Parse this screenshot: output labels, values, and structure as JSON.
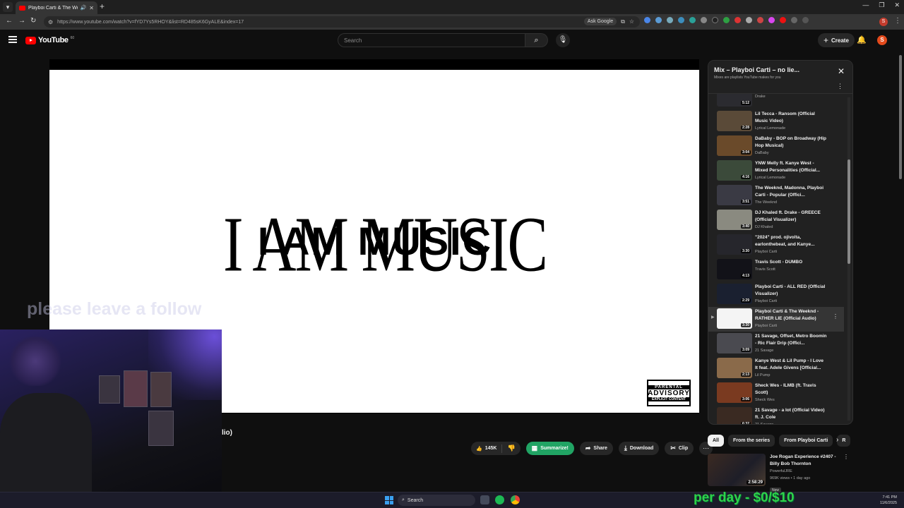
{
  "browser": {
    "tab_title": "Playboi Carti & The Weeknd",
    "url": "https://www.youtube.com/watch?v=fYD7Ys5RHOY&list=RD485sK6GyALE&index=17",
    "ask_google_label": "Ask Google",
    "account_initial": "S"
  },
  "header": {
    "logo_text": "YouTube",
    "logo_region": "60",
    "search_placeholder": "Search",
    "create_label": "Create",
    "avatar_initial": "S"
  },
  "player": {
    "art_line_1": "I AM MUSIC",
    "art_line_2": "I AM MUSIC",
    "advisory_top": "PARENTAL",
    "advisory_mid": "ADVISORY",
    "advisory_bottom": "EXPLICIT CONTENT"
  },
  "stream_overlay": {
    "follow_text": "please leave a follow",
    "per_day_text": "per day - $0/$10"
  },
  "video": {
    "title_fragment": "lio)",
    "like_count": "145K",
    "summarize_label": "Summarize!",
    "share_label": "Share",
    "download_label": "Download",
    "clip_label": "Clip"
  },
  "playlist": {
    "title": "Mix – Playboi Carti – no lie...",
    "subtitle": "Mixes are playlists YouTube makes for you",
    "items": [
      {
        "title": "Music Video)",
        "channel": "Drake",
        "duration": "5:12",
        "thumb": "#2b2b30"
      },
      {
        "title": "Lil Tecca - Ransom (Official Music Video)",
        "channel": "Lyrical Lemonade",
        "duration": "2:28",
        "thumb": "#5a4a38"
      },
      {
        "title": "DaBaby - BOP on Broadway (Hip Hop Musical)",
        "channel": "DaBaby",
        "duration": "3:04",
        "thumb": "#6a4a2a"
      },
      {
        "title": "YNW Melly ft. Kanye West - Mixed Personalities (Official...",
        "channel": "Lyrical Lemonade",
        "duration": "4:16",
        "thumb": "#3b4a3a"
      },
      {
        "title": "The Weeknd, Madonna, Playboi Carti - Popular (Offici...",
        "channel": "The Weeknd",
        "duration": "3:51",
        "thumb": "#3a3a44"
      },
      {
        "title": "DJ Khaled ft. Drake - GREECE (Official Visualizer)",
        "channel": "DJ Khaled",
        "duration": "3:40",
        "thumb": "#8a8a80"
      },
      {
        "title": "\"2024\" prod. ojivolta, earlonthebeat, and Kanye...",
        "channel": "Playboi Carti",
        "duration": "3:30",
        "thumb": "#26262c"
      },
      {
        "title": "Travis Scott - DUMBO",
        "channel": "Travis Scott",
        "duration": "4:13",
        "thumb": "#121218"
      },
      {
        "title": "Playboi Carti - ALL RED (Official Visualizer)",
        "channel": "Playboi Carti",
        "duration": "2:29",
        "thumb": "#1a2030"
      },
      {
        "title": "Playboi Carti & The Weeknd - RATHER LIE (Official Audio)",
        "channel": "Playboi Carti",
        "duration": "3:30",
        "thumb": "#f4f4f4",
        "current": true
      },
      {
        "title": "21 Savage, Offset, Metro Boomin - Ric Flair Drip (Offici...",
        "channel": "21 Savage",
        "duration": "3:09",
        "thumb": "#4a4a50"
      },
      {
        "title": "Kanye West & Lil Pump - I Love It feat. Adele Givens [Official...",
        "channel": "Lil Pump",
        "duration": "2:13",
        "thumb": "#8a6a4a"
      },
      {
        "title": "Sheck Wes - ILMB (ft. Travis Scott)",
        "channel": "Sheck Wes",
        "duration": "3:06",
        "thumb": "#7a3a20"
      },
      {
        "title": "21 Savage - a lot (Official Video) ft. J. Cole",
        "channel": "21 Savage",
        "duration": "6:32",
        "thumb": "#3a2a22"
      }
    ]
  },
  "chips": [
    "All",
    "From the series",
    "From Playboi Carti",
    "R"
  ],
  "recommended": {
    "title": "Joe Rogan Experience #2407 - Billy Bob Thornton",
    "channel": "PowerfulJRE",
    "meta": "969K views • 1 day ago",
    "badge": "New",
    "duration": "2:58:29"
  },
  "taskbar": {
    "search_label": "Search",
    "time": "7:41 PM",
    "date": "11/6/2025"
  }
}
